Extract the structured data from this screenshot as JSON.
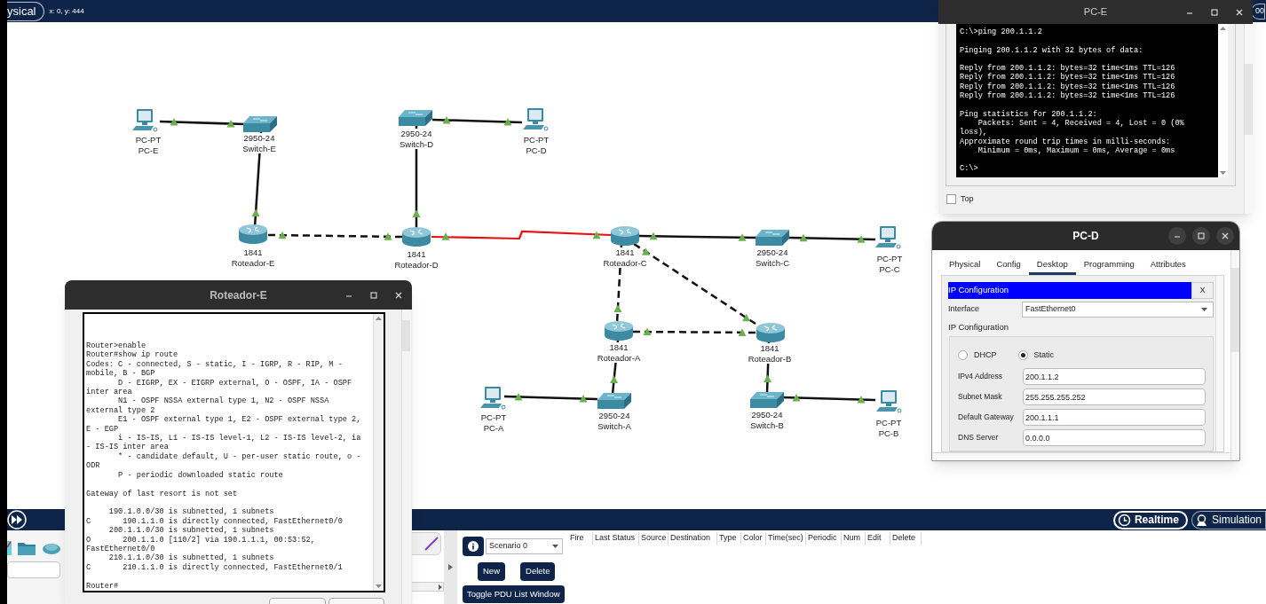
{
  "toolbar": {
    "mode_tab": "ysical",
    "coordinates": "x: 0, y: 444",
    "clock_fragment": "00"
  },
  "topology": {
    "devices": [
      {
        "kind": "pc",
        "model": "PC-PT",
        "name": "PC-E"
      },
      {
        "kind": "switch",
        "model": "2950-24",
        "name": "Switch-E"
      },
      {
        "kind": "switch",
        "model": "2950-24",
        "name": "Switch-D"
      },
      {
        "kind": "pc",
        "model": "PC-PT",
        "name": "PC-D"
      },
      {
        "kind": "router",
        "model": "1841",
        "name": "Roteador-E"
      },
      {
        "kind": "router",
        "model": "1841",
        "name": "Roteador-D"
      },
      {
        "kind": "router",
        "model": "1841",
        "name": "Roteador-C"
      },
      {
        "kind": "switch",
        "model": "2950-24",
        "name": "Switch-C"
      },
      {
        "kind": "pc",
        "model": "PC-PT",
        "name": "PC-C"
      },
      {
        "kind": "router",
        "model": "1841",
        "name": "Roteador-A"
      },
      {
        "kind": "router",
        "model": "1841",
        "name": "Roteador-B"
      },
      {
        "kind": "pc",
        "model": "PC-PT",
        "name": "PC-A"
      },
      {
        "kind": "switch",
        "model": "2950-24",
        "name": "Switch-A"
      },
      {
        "kind": "switch",
        "model": "2950-24",
        "name": "Switch-B"
      },
      {
        "kind": "pc",
        "model": "PC-PT",
        "name": "PC-B"
      }
    ],
    "links": [
      {
        "kind": "straight"
      },
      {
        "kind": "straight"
      },
      {
        "kind": "cross"
      },
      {
        "kind": "straight"
      },
      {
        "kind": "straight"
      },
      {
        "kind": "serial"
      },
      {
        "kind": "straight"
      },
      {
        "kind": "straight"
      },
      {
        "kind": "cross"
      },
      {
        "kind": "cross"
      },
      {
        "kind": "cross"
      },
      {
        "kind": "straight"
      },
      {
        "kind": "straight"
      },
      {
        "kind": "straight"
      },
      {
        "kind": "straight"
      }
    ]
  },
  "router_cli_window": {
    "title": "Roteador-E",
    "output": "Router>enable\nRouter#show ip route\nCodes: C - connected, S - static, I - IGRP, R - RIP, M -\nmobile, B - BGP\n       D - EIGRP, EX - EIGRP external, O - OSPF, IA - OSPF\ninter area\n       N1 - OSPF NSSA external type 1, N2 - OSPF NSSA\nexternal type 2\n       E1 - OSPF external type 1, E2 - OSPF external type 2,\nE - EGP\n       i - IS-IS, L1 - IS-IS level-1, L2 - IS-IS level-2, ia\n- IS-IS inter area\n       * - candidate default, U - per-user static route, o -\nODR\n       P - periodic downloaded static route\n\nGateway of last resort is not set\n\n     190.1.0.0/30 is subnetted, 1 subnets\nC       190.1.1.0 is directly connected, FastEthernet0/0\n     200.1.1.0/30 is subnetted, 1 subnets\nO       200.1.1.0 [110/2] via 190.1.1.1, 00:53:52,\nFastEthernet0/0\n     210.1.1.0/30 is subnetted, 1 subnets\nC       210.1.1.0 is directly connected, FastEthernet0/1\n\nRouter#"
  },
  "pc_e_window": {
    "title": "PC-E",
    "output": "C:\\>ping 200.1.1.2\n\nPinging 200.1.1.2 with 32 bytes of data:\n\nReply from 200.1.1.2: bytes=32 time<1ms TTL=126\nReply from 200.1.1.2: bytes=32 time<1ms TTL=126\nReply from 200.1.1.2: bytes=32 time<1ms TTL=126\nReply from 200.1.1.2: bytes=32 time<1ms TTL=126\n\nPing statistics for 200.1.1.2:\n    Packets: Sent = 4, Received = 4, Lost = 0 (0%\nloss),\nApproximate round trip times in milli-seconds:\n    Minimum = 0ms, Maximum = 0ms, Average = 0ms\n\nC:\\>",
    "top_checkbox": {
      "label": "Top",
      "checked": false
    }
  },
  "pc_d_window": {
    "title": "PC-D",
    "tabs": [
      {
        "label": "Physical",
        "selected": false
      },
      {
        "label": "Config",
        "selected": false
      },
      {
        "label": "Desktop",
        "selected": true
      },
      {
        "label": "Programming",
        "selected": false
      },
      {
        "label": "Attributes",
        "selected": false
      }
    ],
    "panel": {
      "title": "IP Configuration",
      "close": "X",
      "interface_label": "Interface",
      "interface_value": "FastEthernet0",
      "section": "IP Configuration",
      "modes": [
        {
          "label": "DHCP",
          "selected": false
        },
        {
          "label": "Static",
          "selected": true
        }
      ],
      "fields": [
        {
          "label": "IPv4 Address",
          "value": "200.1.1.2"
        },
        {
          "label": "Subnet Mask",
          "value": "255.255.255.252"
        },
        {
          "label": "Default Gateway",
          "value": "200.1.1.1"
        },
        {
          "label": "DNS Server",
          "value": "0.0.0.0"
        }
      ]
    }
  },
  "mode_buttons": [
    {
      "label": "Realtime",
      "selected": true
    },
    {
      "label": "Simulation",
      "selected": false
    }
  ],
  "scenario": {
    "value": "Scenario 0",
    "buttons": [
      "New",
      "Delete"
    ],
    "toggle": "Toggle PDU List Window"
  },
  "event_list": {
    "columns": [
      "Fire",
      "Last Status",
      "Source",
      "Destination",
      "Type",
      "Color",
      "Time(sec)",
      "Periodic",
      "Num",
      "Edit",
      "Delete"
    ]
  }
}
